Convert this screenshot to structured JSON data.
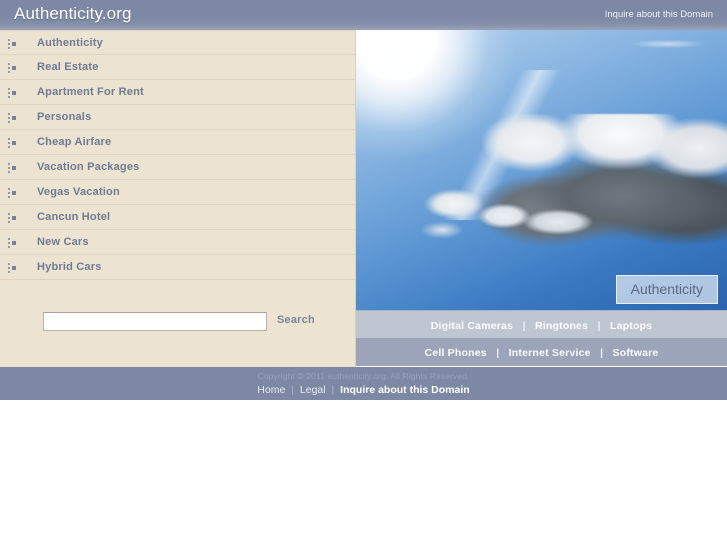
{
  "header": {
    "brand": "Authenticity.org",
    "inquire_label": "Inquire about this Domain"
  },
  "sidebar": {
    "nav_items": [
      {
        "label": "Authenticity",
        "icon": "list-bullet-icon"
      },
      {
        "label": "Real Estate",
        "icon": "list-bullet-icon"
      },
      {
        "label": "Apartment For Rent",
        "icon": "list-bullet-icon"
      },
      {
        "label": "Personals",
        "icon": "list-bullet-icon"
      },
      {
        "label": "Cheap Airfare",
        "icon": "list-bullet-icon"
      },
      {
        "label": "Vacation Packages",
        "icon": "list-bullet-icon"
      },
      {
        "label": "Vegas Vacation",
        "icon": "list-bullet-icon"
      },
      {
        "label": "Cancun Hotel",
        "icon": "list-bullet-icon"
      },
      {
        "label": "New Cars",
        "icon": "list-bullet-icon"
      },
      {
        "label": "Hybrid Cars",
        "icon": "list-bullet-icon"
      }
    ],
    "search": {
      "value": "",
      "placeholder": "",
      "button_label": "Search"
    }
  },
  "photo": {
    "alt": "sunlit sky with cumulus cloud",
    "watermark": "Authenticity"
  },
  "link_bars": {
    "row1": [
      "Digital Cameras",
      "Ringtones",
      "Laptops"
    ],
    "row2": [
      "Cell Phones",
      "Internet Service",
      "Software"
    ],
    "separator": "|"
  },
  "footer": {
    "copyright": "Copyright © 2011 authenticity.org. All Rights Reserved.",
    "links": [
      "Home",
      "Legal",
      "Inquire about this Domain"
    ],
    "separator": "|"
  },
  "colors": {
    "header_bg": "#7d88a4",
    "sidebar_bg": "#ece3d1",
    "sidebar_border": "#ded4c1",
    "nav_text": "#6f7a95",
    "stripe_light": "#bec6d2",
    "stripe_dark": "#9ba4b9",
    "footer_bg": "#7d88a4",
    "page_bg": "#ffffff"
  }
}
